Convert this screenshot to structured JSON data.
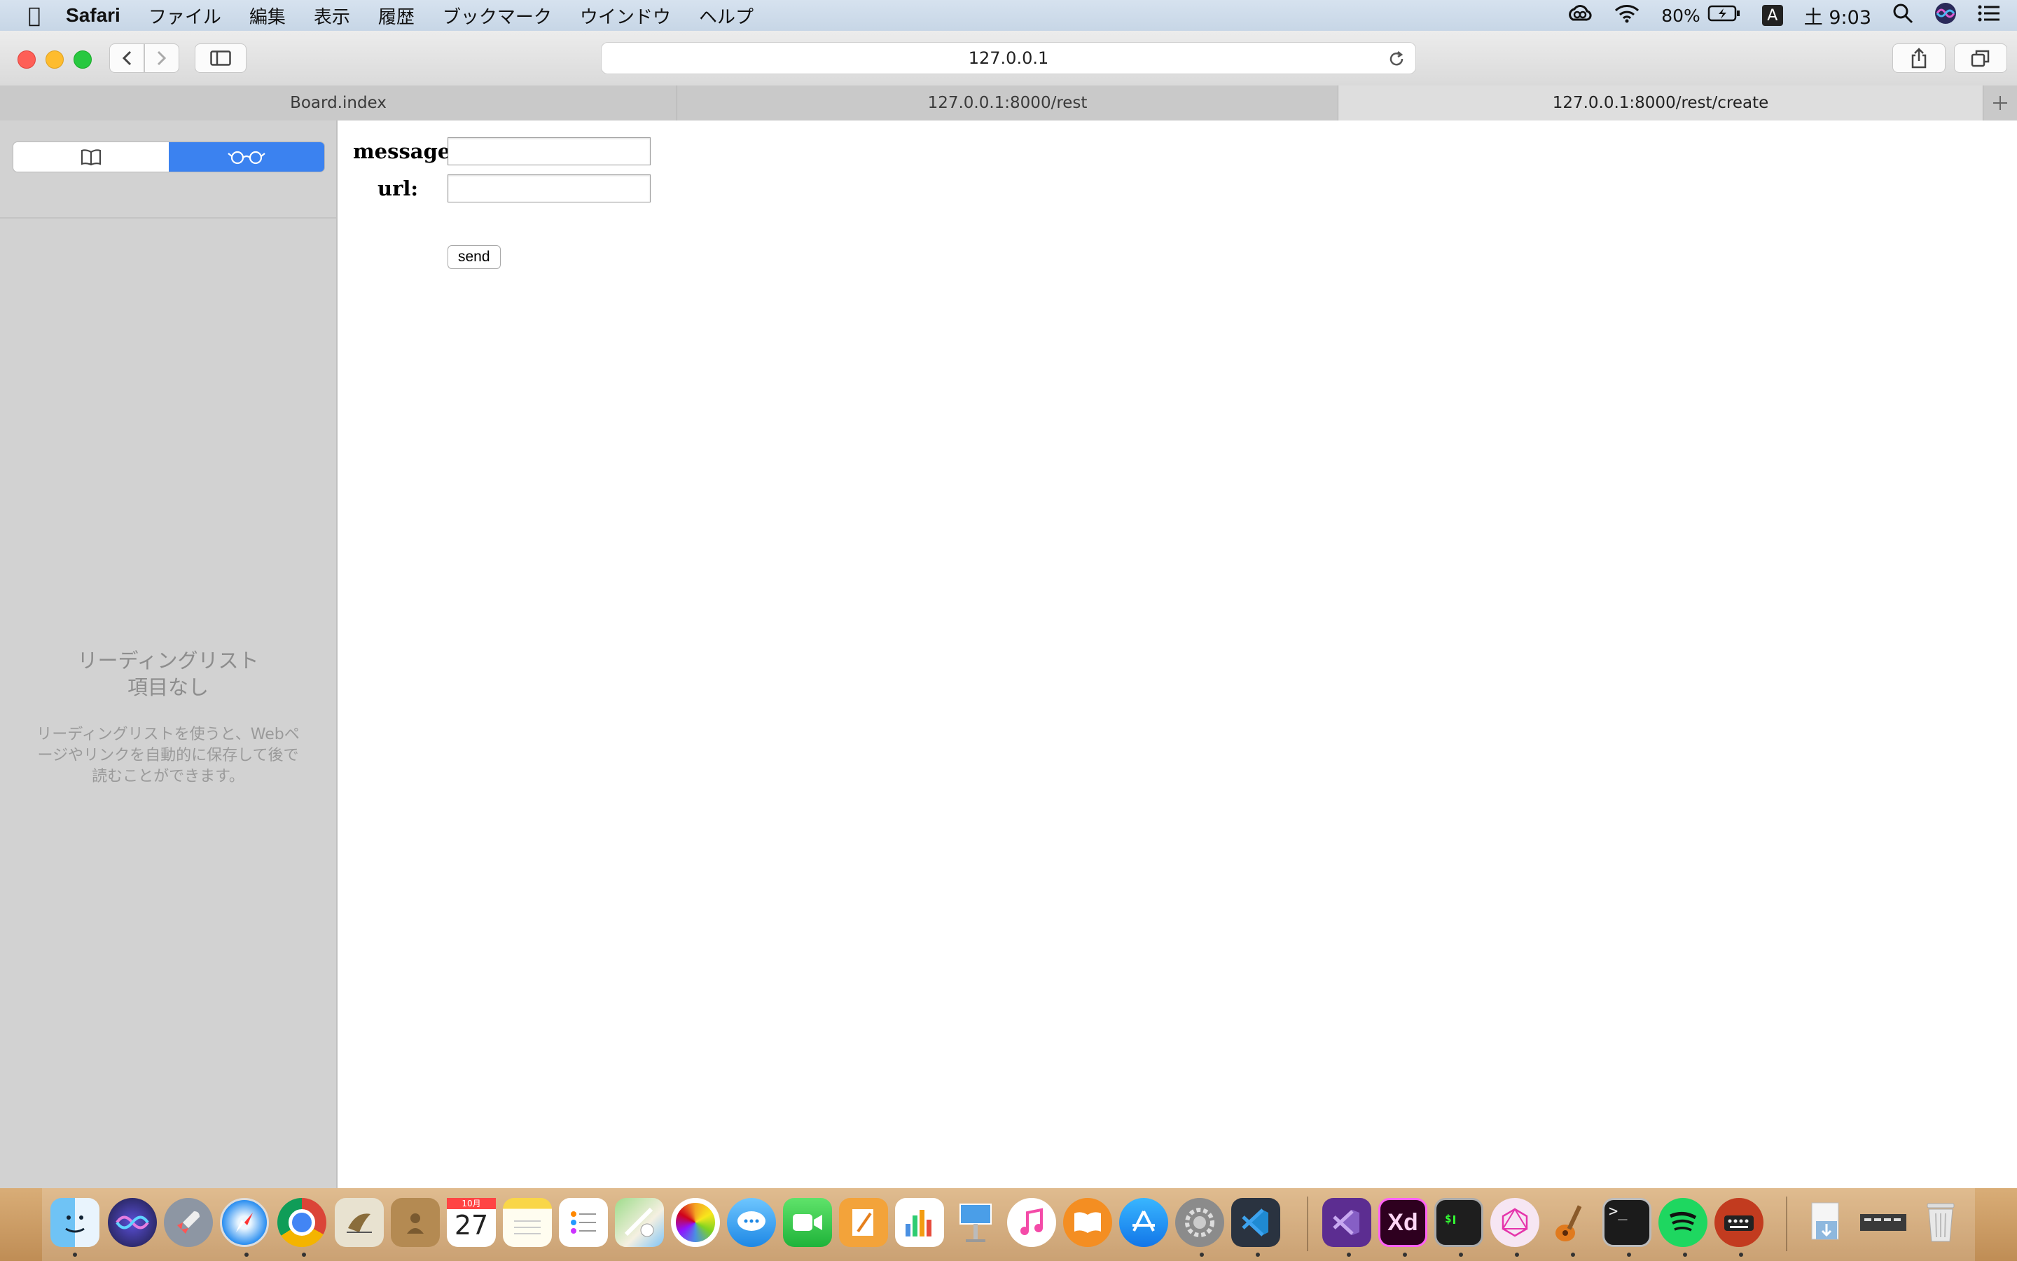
{
  "menubar": {
    "app_name": "Safari",
    "items": [
      "ファイル",
      "編集",
      "表示",
      "履歴",
      "ブックマーク",
      "ウインドウ",
      "ヘルプ"
    ],
    "battery": "80%",
    "input_mode": "A",
    "clock": "土 9:03"
  },
  "toolbar": {
    "address": "127.0.0.1"
  },
  "tabs": [
    {
      "label": "Board.index"
    },
    {
      "label": "127.0.0.1:8000/rest"
    },
    {
      "label": "127.0.0.1:8000/rest/create"
    }
  ],
  "sidebar": {
    "empty_title_line1": "リーディングリスト",
    "empty_title_line2": "項目なし",
    "empty_desc": "リーディングリストを使うと、Webページやリンクを自動的に保存して後で読むことができます。"
  },
  "form": {
    "message_label": "message:",
    "message_value": "",
    "url_label": "url:",
    "url_value": "",
    "send_label": "send"
  },
  "dock": {
    "calendar_day": "27",
    "calendar_month": "10月",
    "xd_label": "Xd",
    "terminal_label": ">_"
  },
  "colors": {
    "accent": "#3b82f0",
    "close": "#fe5f57",
    "minimize": "#febc2e",
    "zoom": "#28c840"
  }
}
